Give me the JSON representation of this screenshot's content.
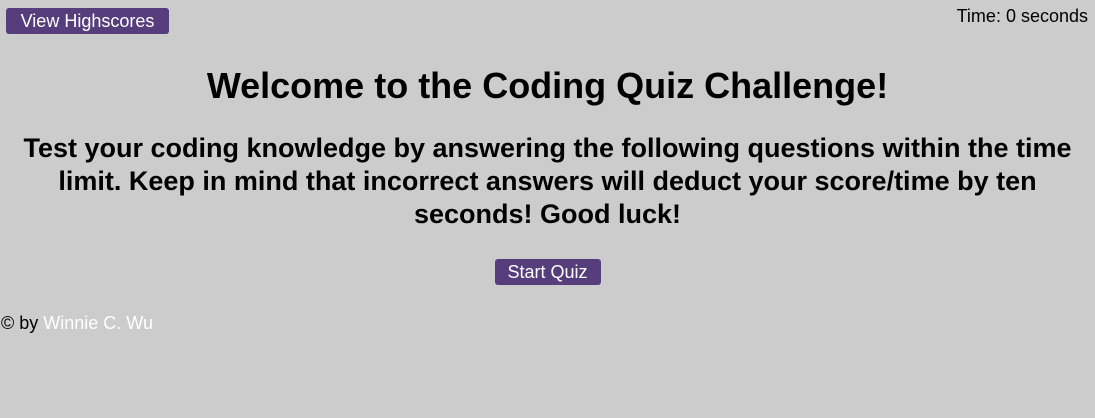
{
  "header": {
    "highscores_label": "View Highscores",
    "timer_text": "Time: 0 seconds"
  },
  "main": {
    "title": "Welcome to the Coding Quiz Challenge!",
    "intro": "Test your coding knowledge by answering the following questions within the time limit. Keep in mind that incorrect answers will deduct your score/time by ten seconds! Good luck!",
    "start_label": "Start Quiz"
  },
  "footer": {
    "prefix": "© by",
    "author_link": "Winnie C. Wu"
  },
  "colors": {
    "background": "#cccccc",
    "button": "#563d7c",
    "link": "#ffffff"
  }
}
